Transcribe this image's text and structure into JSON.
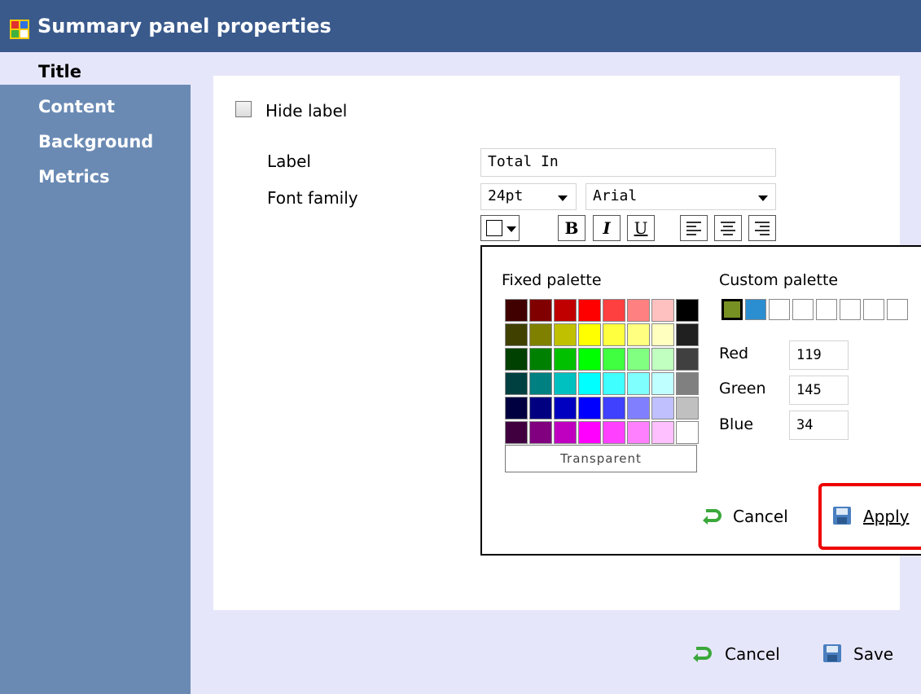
{
  "window": {
    "title": "Summary panel properties"
  },
  "sidebar": {
    "items": [
      {
        "label": "Title",
        "active": true
      },
      {
        "label": "Content",
        "active": false
      },
      {
        "label": "Background",
        "active": false
      },
      {
        "label": "Metrics",
        "active": false
      }
    ]
  },
  "form": {
    "hide_label": {
      "text": "Hide label",
      "checked": false
    },
    "label_field": {
      "caption": "Label",
      "value": "Total In"
    },
    "font_family": {
      "caption": "Font family",
      "size_value": "24pt",
      "font_value": "Arial"
    },
    "toolbar": {
      "bold": "B",
      "italic": "I",
      "underline": "U"
    }
  },
  "color_popup": {
    "fixed_title": "Fixed palette",
    "custom_title": "Custom palette",
    "fixed_colors": [
      [
        "#400000",
        "#800000",
        "#c00000",
        "#ff0000",
        "#ff4040",
        "#ff8080",
        "#ffc0c0",
        "#000000"
      ],
      [
        "#404000",
        "#808000",
        "#c0c000",
        "#ffff00",
        "#ffff40",
        "#ffff80",
        "#ffffc0",
        "#202020"
      ],
      [
        "#004000",
        "#008000",
        "#00c000",
        "#00ff00",
        "#40ff40",
        "#80ff80",
        "#c0ffc0",
        "#404040"
      ],
      [
        "#004040",
        "#008080",
        "#00c0c0",
        "#00ffff",
        "#40ffff",
        "#80ffff",
        "#c0ffff",
        "#808080"
      ],
      [
        "#000040",
        "#000080",
        "#0000c0",
        "#0000ff",
        "#4040ff",
        "#8080ff",
        "#c0c0ff",
        "#c0c0c0"
      ],
      [
        "#400040",
        "#800080",
        "#c000c0",
        "#ff00ff",
        "#ff40ff",
        "#ff80ff",
        "#ffc0ff",
        "#ffffff"
      ]
    ],
    "custom_colors": [
      "#779122",
      "#2b8ed0",
      "#ffffff",
      "#ffffff",
      "#ffffff",
      "#ffffff",
      "#ffffff",
      "#ffffff"
    ],
    "red": {
      "label": "Red",
      "value": "119"
    },
    "green": {
      "label": "Green",
      "value": "145"
    },
    "blue": {
      "label": "Blue",
      "value": "34"
    },
    "transparent_label": "Transparent",
    "cancel_label": "Cancel",
    "apply_label": "Apply"
  },
  "footer": {
    "cancel_label": "Cancel",
    "save_label": "Save"
  }
}
